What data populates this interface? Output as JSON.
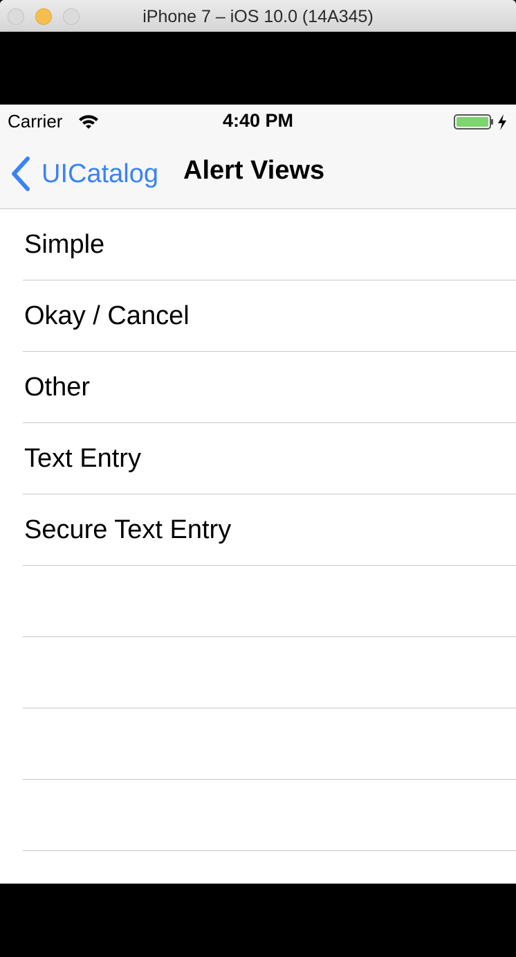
{
  "window": {
    "title": "iPhone 7 – iOS 10.0 (14A345)"
  },
  "status_bar": {
    "carrier": "Carrier",
    "time": "4:40 PM",
    "wifi_icon": "wifi-icon",
    "battery_icon": "battery-charging-icon",
    "battery_color": "#7ed46f"
  },
  "nav_bar": {
    "back_label": "UICatalog",
    "back_icon": "chevron-left-icon",
    "title": "Alert Views",
    "tint": "#3a82f7"
  },
  "table": {
    "rows": [
      {
        "label": "Simple"
      },
      {
        "label": "Okay / Cancel"
      },
      {
        "label": "Other"
      },
      {
        "label": "Text Entry"
      },
      {
        "label": "Secure Text Entry"
      }
    ]
  }
}
